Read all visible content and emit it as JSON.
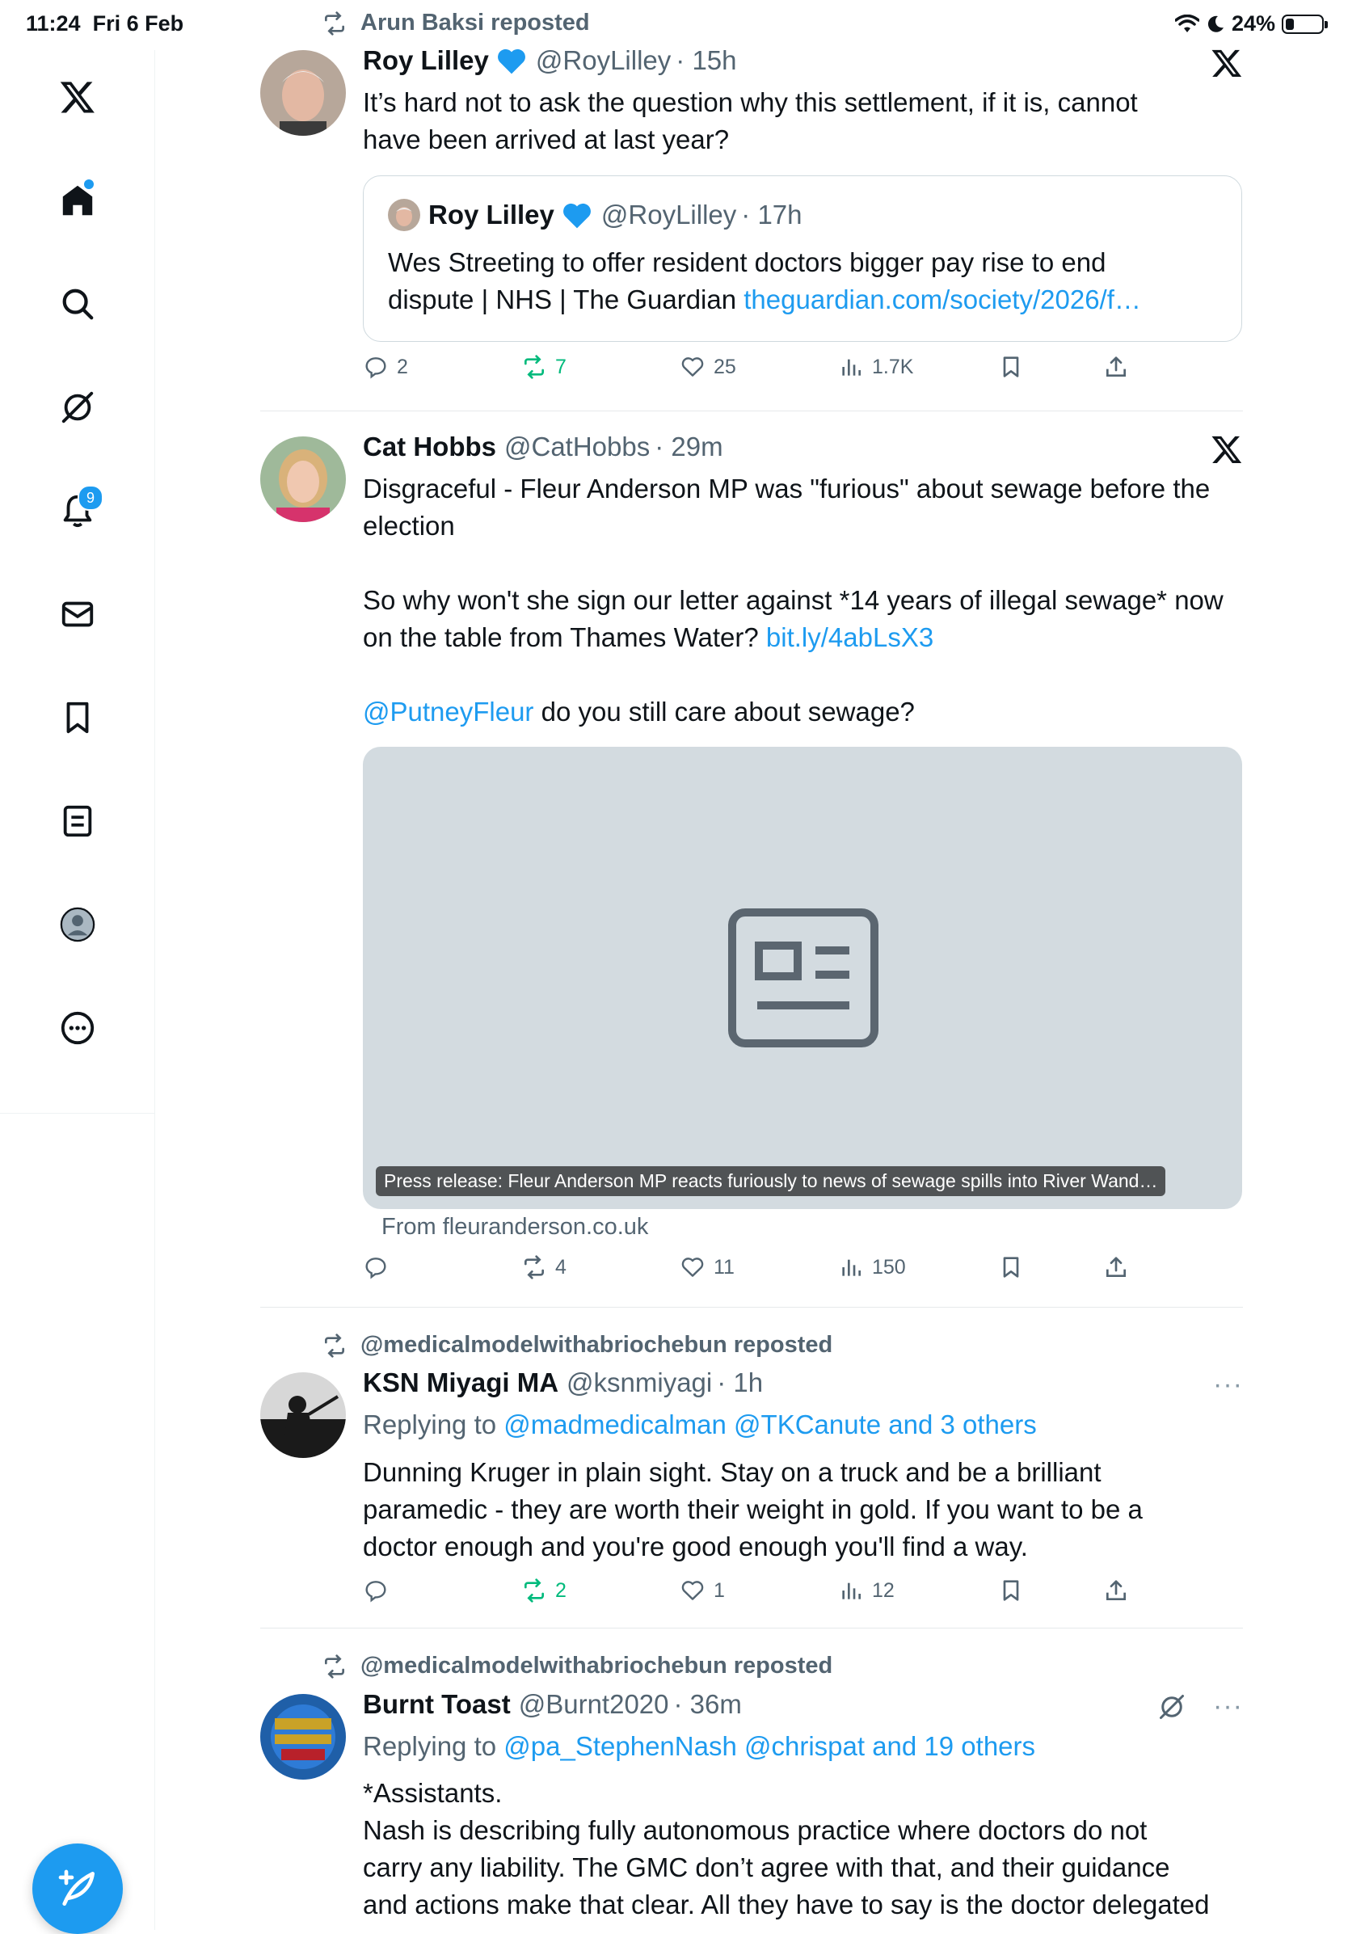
{
  "status_bar": {
    "time": "11:24",
    "date": "Fri 6 Feb",
    "battery": "24%"
  },
  "sidebar": {
    "items": [
      {
        "name": "logo"
      },
      {
        "name": "home"
      },
      {
        "name": "explore"
      },
      {
        "name": "grok"
      },
      {
        "name": "notifications",
        "badge": "9"
      },
      {
        "name": "messages"
      },
      {
        "name": "bookmarks"
      },
      {
        "name": "lists"
      },
      {
        "name": "profile"
      },
      {
        "name": "more"
      }
    ]
  },
  "posts": [
    {
      "repost_by": "Arun Baksi reposted",
      "author": "Roy Lilley",
      "handle": "@RoyLilley",
      "time": "· 15h",
      "text_lines": [
        "It’s hard not to ask the question why this settlement, if it is, cannot",
        "have been arrived at last year?"
      ],
      "quote": {
        "author": "Roy Lilley",
        "handle": "@RoyLilley",
        "time": "· 17h",
        "text_line1": "Wes Streeting to offer resident doctors bigger pay rise to end",
        "text_line2": "dispute | NHS | The Guardian ",
        "link": "theguardian.com/society/2026/f…"
      },
      "stats": {
        "replies": "2",
        "reposts": "7",
        "likes": "25",
        "views": "1.7K"
      }
    },
    {
      "author": "Cat Hobbs",
      "handle": "@CatHobbs",
      "time": "· 29m",
      "text_lines": [
        "Disgraceful - Fleur Anderson MP was \"furious\" about sewage before the",
        "election"
      ],
      "text_p2_line1": "So why won't she sign our letter against *14 years of illegal sewage* now",
      "text_p2_line2": "on the table from Thames Water? ",
      "text_p2_link": "bit.ly/4abLsX3",
      "mention": "@PutneyFleur",
      "text_p3_rest": " do you still care about sewage?",
      "card_caption": "Press release: Fleur Anderson MP reacts furiously to news of sewage spills into River Wand…",
      "card_source": "From fleuranderson.co.uk",
      "stats": {
        "replies": "",
        "reposts": "4",
        "likes": "11",
        "views": "150"
      }
    },
    {
      "repost_by": "@medicalmodelwithabriochebun reposted",
      "author": "KSN Miyagi MA",
      "handle": "@ksnmiyagi",
      "time": "· 1h",
      "replying_prefix": "Replying to ",
      "replying_to": "@madmedicalman @TKCanute and 3 others",
      "text_lines": [
        "Dunning Kruger in plain sight. Stay on a truck and be a brilliant",
        "paramedic - they are worth their weight in gold. If you want to be a",
        "doctor enough and you're good enough you'll find a way."
      ],
      "stats": {
        "replies": "",
        "reposts": "2",
        "likes": "1",
        "views": "12"
      }
    },
    {
      "repost_by": "@medicalmodelwithabriochebun reposted",
      "author": "Burnt Toast",
      "handle": "@Burnt2020",
      "time": "· 36m",
      "replying_prefix": "Replying to ",
      "replying_to": "@pa_StephenNash @chrispat and 19 others",
      "text_lines": [
        "*Assistants.",
        "Nash is describing fully autonomous practice where doctors do not",
        "carry any liability. The GMC don’t agree with that, and their guidance",
        "and actions make that clear. All they have to say is the doctor delegated"
      ]
    }
  ],
  "more_label": "···",
  "colors": {
    "accent": "#1d9bf0",
    "repost_green": "#00ba7c",
    "muted": "#536471"
  }
}
